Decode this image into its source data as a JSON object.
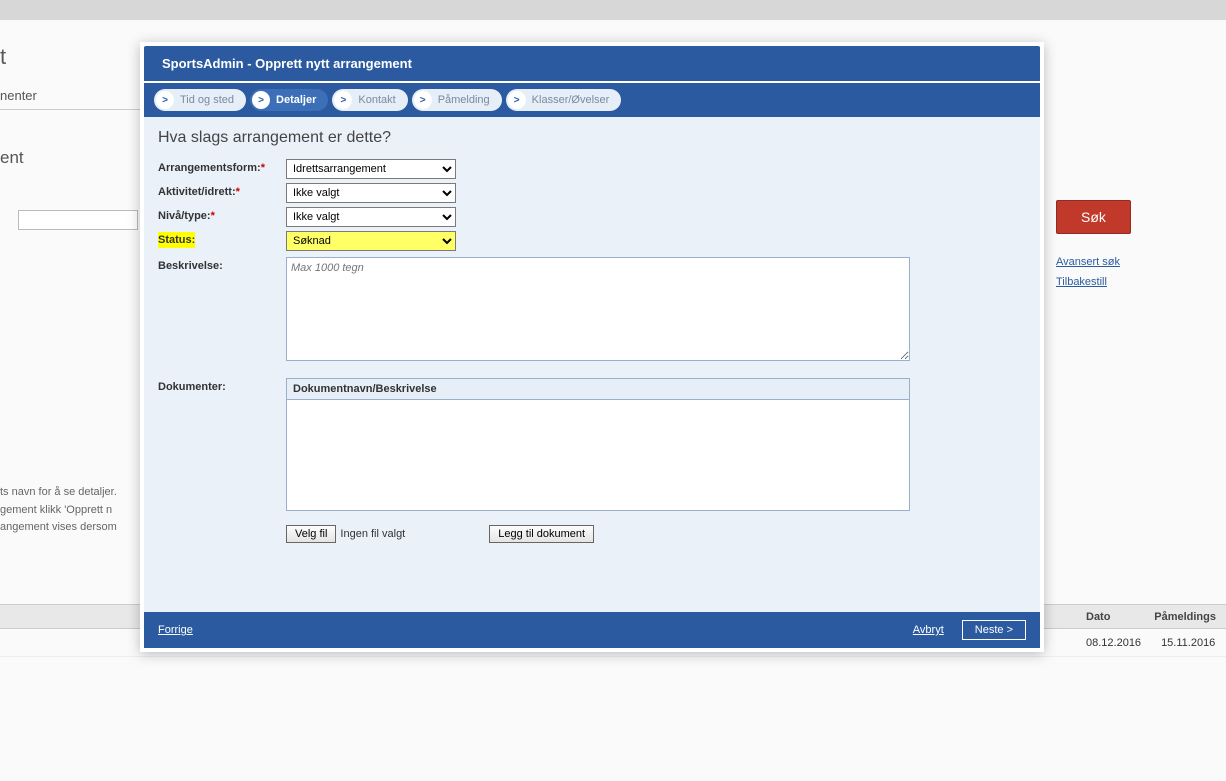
{
  "background": {
    "heading_fragment": "t",
    "sub_fragment": "nenter",
    "sub2_fragment": "ent",
    "help_lines": [
      "ts navn for å se detaljer.",
      "gement klikk 'Opprett n",
      "angement vises dersom"
    ],
    "search_button": "Søk",
    "adv_link": "Avansert søk",
    "reset_link": "Tilbakestill",
    "table": {
      "col_dato": "Dato",
      "col_pam": "Påmeldings",
      "row_dato": "08.12.2016",
      "row_pam": "15.11.2016"
    }
  },
  "modal": {
    "title": "SportsAdmin - Opprett nytt arrangement",
    "chevron": ">",
    "steps": [
      {
        "label": "Tid og sted",
        "active": false
      },
      {
        "label": "Detaljer",
        "active": true
      },
      {
        "label": "Kontakt",
        "active": false
      },
      {
        "label": "Påmelding",
        "active": false
      },
      {
        "label": "Klasser/Øvelser",
        "active": false
      }
    ],
    "section_title": "Hva slags arrangement er dette?",
    "form": {
      "arrform_label": "Arrangementsform:",
      "arrform_value": "Idrettsarrangement",
      "aktivitet_label": "Aktivitet/idrett:",
      "aktivitet_value": "Ikke valgt",
      "niva_label": "Nivå/type:",
      "niva_value": "Ikke valgt",
      "status_label": "Status:",
      "status_value": "Søknad",
      "beskrivelse_label": "Beskrivelse:",
      "beskrivelse_placeholder": "Max 1000 tegn",
      "dokumenter_label": "Dokumenter:",
      "doc_header": "Dokumentnavn/Beskrivelse",
      "velg_fil": "Velg fil",
      "ingen_fil": "Ingen fil valgt",
      "legg_til": "Legg til dokument"
    },
    "footer": {
      "prev": "Forrige",
      "cancel": "Avbryt",
      "next": "Neste >"
    }
  }
}
